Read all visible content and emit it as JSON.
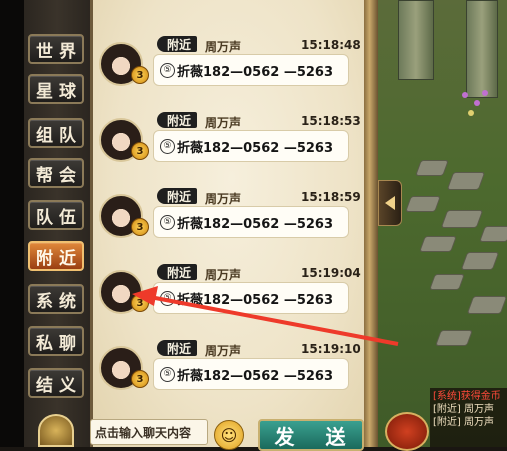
{
  "tabs": [
    {
      "label": "世界",
      "active": false
    },
    {
      "label": "星球",
      "active": false
    },
    {
      "label": "组队",
      "active": false
    },
    {
      "label": "帮会",
      "active": false
    },
    {
      "label": "队伍",
      "active": false
    },
    {
      "label": "附近",
      "active": true
    },
    {
      "label": "系统",
      "active": false
    },
    {
      "label": "私聊",
      "active": false
    },
    {
      "label": "结义",
      "active": false
    }
  ],
  "messages": [
    {
      "channel": "附近",
      "sender": "周万声",
      "time": "15:18:48",
      "level": "3",
      "text": "折薇182—0562 —5263",
      "icon": "⑤"
    },
    {
      "channel": "附近",
      "sender": "周万声",
      "time": "15:18:53",
      "level": "3",
      "text": "折薇182—0562 —5263",
      "icon": "⑤"
    },
    {
      "channel": "附近",
      "sender": "周万声",
      "time": "15:18:59",
      "level": "3",
      "text": "折薇182—0562 —5263",
      "icon": "⑤"
    },
    {
      "channel": "附近",
      "sender": "周万声",
      "time": "15:19:04",
      "level": "3",
      "text": "折薇182—0562 —5263",
      "icon": "⑤"
    },
    {
      "channel": "附近",
      "sender": "周万声",
      "time": "15:19:10",
      "level": "3",
      "text": "折薇182—0562 —5263",
      "icon": "⑤"
    }
  ],
  "input": {
    "placeholder": "点击输入聊天内容"
  },
  "send_label": "发 送",
  "emoji_icon": "☺",
  "system_log": [
    {
      "text": "[系统]获得金币",
      "color": "#ff4a3a"
    },
    {
      "text": "[附近] 周万声",
      "color": "#f0e0c0"
    },
    {
      "text": "[附近] 周万声",
      "color": "#f0e0c0"
    }
  ],
  "colors": {
    "active_tab": "#e0883a",
    "send_button": "#2a8a78",
    "arrow": "#ee3a2a"
  }
}
